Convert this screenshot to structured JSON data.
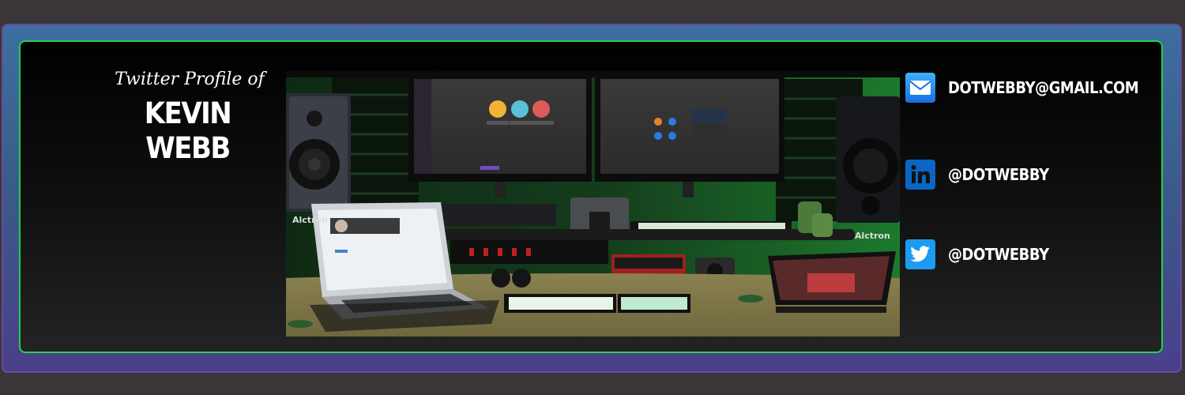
{
  "header": {
    "subtitle": "Twitter Profile of",
    "name": "KEVIN WEBB"
  },
  "contacts": {
    "email": {
      "icon": "mail-icon",
      "label": "DOTWEBBY@GMAIL.COM"
    },
    "linkedin": {
      "icon": "linkedin-icon",
      "label": "@DOTWEBBY"
    },
    "twitter": {
      "icon": "twitter-bird-icon",
      "label": "@DOTWEBBY"
    }
  },
  "photo": {
    "speaker_brand": "Alctron"
  },
  "colors": {
    "accent_green": "#22d34a",
    "outer_blue": "#3d6fa0",
    "email_blue": "#1a6fe0",
    "linkedin_blue": "#0a66c2",
    "twitter_blue": "#1d9bf0"
  }
}
